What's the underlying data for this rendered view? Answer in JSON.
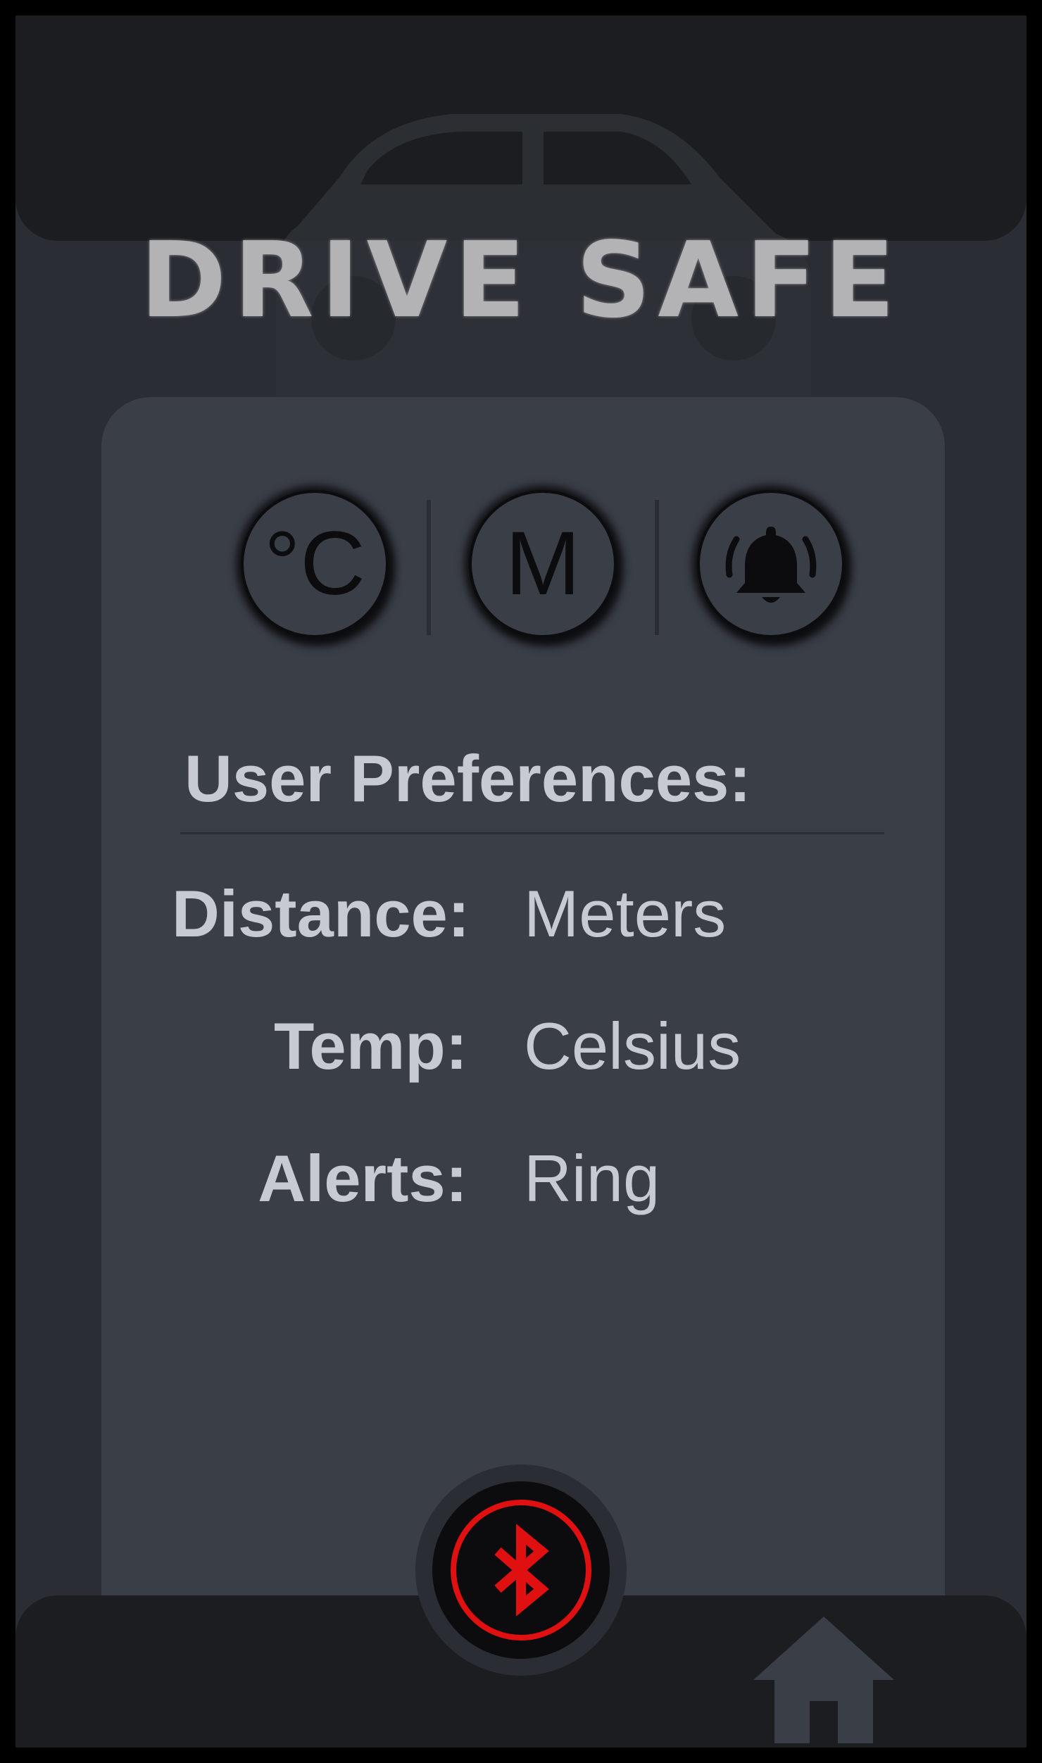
{
  "app": {
    "title": "DRIVE SAFE"
  },
  "modes": {
    "temp_button": {
      "text": "°C",
      "icon": "celsius-icon"
    },
    "distance_button": {
      "text": "M",
      "icon": "meters-icon"
    },
    "alert_button": {
      "icon": "bell-ringing-icon"
    }
  },
  "preferences": {
    "heading": "User Preferences:",
    "rows": [
      {
        "label": "Distance:",
        "value": "Meters"
      },
      {
        "label": "Temp:",
        "value": "Celsius"
      },
      {
        "label": "Alerts:",
        "value": "Ring"
      }
    ]
  },
  "footer": {
    "bluetooth_icon": "bluetooth-icon",
    "home_icon": "home-icon"
  },
  "colors": {
    "background": "#2a2d33",
    "panel": "#3a3e47",
    "bars": "#1b1d20",
    "text": "#c7cad3",
    "bluetooth_accent": "#e01010"
  }
}
